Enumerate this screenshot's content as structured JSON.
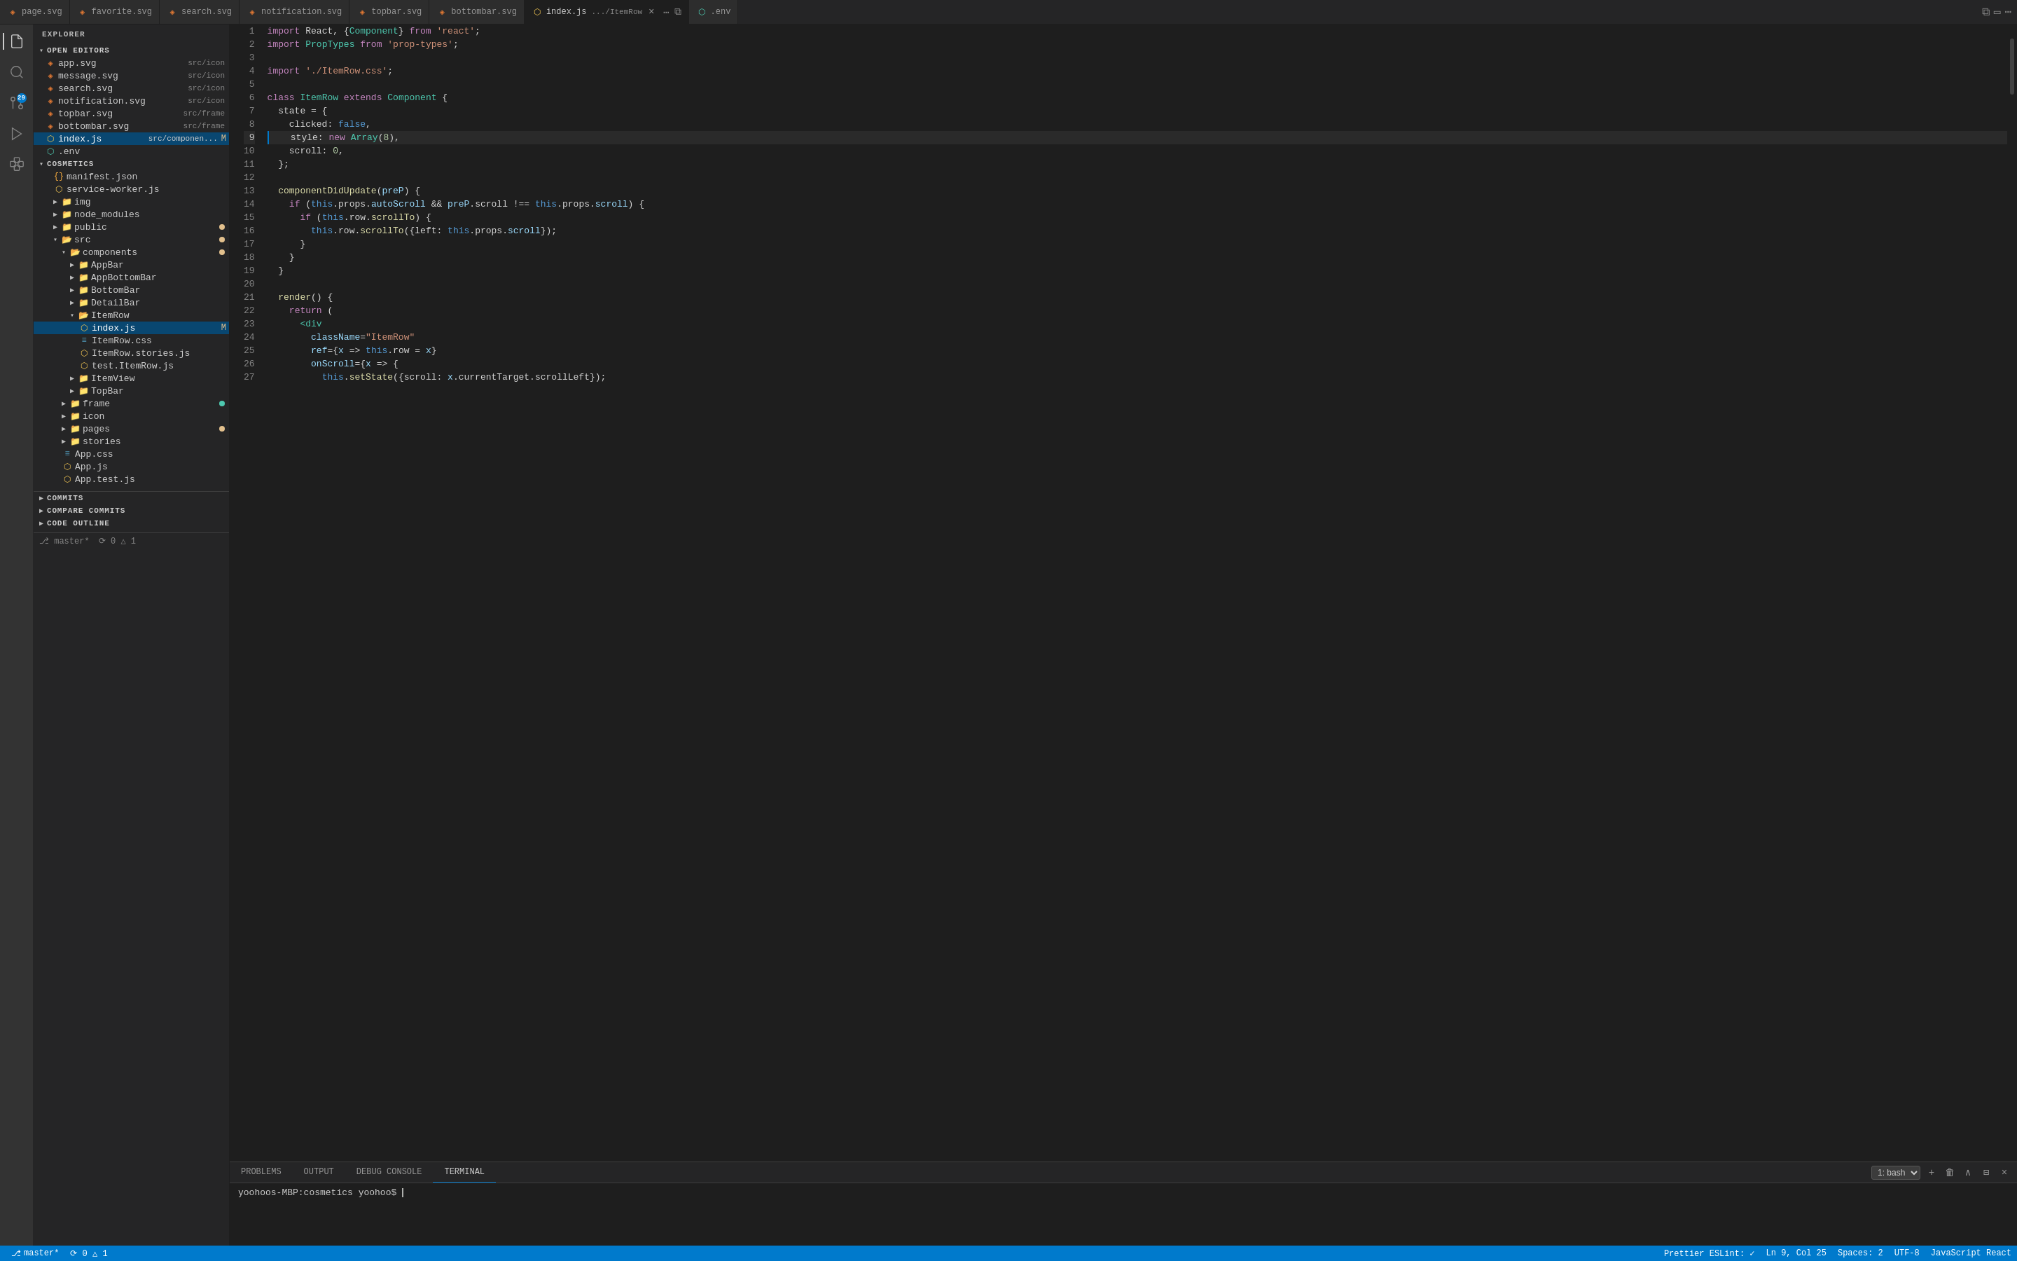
{
  "tabs": [
    {
      "label": "page.svg",
      "active": false,
      "modified": false,
      "color": "#e37933"
    },
    {
      "label": "favorite.svg",
      "active": false,
      "modified": false,
      "color": "#e37933"
    },
    {
      "label": "search.svg",
      "active": false,
      "modified": false,
      "color": "#e37933"
    },
    {
      "label": "notification.svg",
      "active": false,
      "modified": false,
      "color": "#e37933"
    },
    {
      "label": "topbar.svg",
      "active": false,
      "modified": false,
      "color": "#e37933"
    },
    {
      "label": "bottombar.svg",
      "active": false,
      "modified": false,
      "color": "#e37933"
    },
    {
      "label": "index.js",
      "active": true,
      "modified": true,
      "color": "#f1c553",
      "path": ".../ItemRow"
    },
    {
      "label": ".env",
      "active": false,
      "modified": false,
      "color": "#4ec9b0"
    }
  ],
  "sidebar": {
    "title": "EXPLORER",
    "sections": {
      "open_editors": "OPEN EDITORS",
      "cosmetics": "COSMETICS"
    }
  },
  "open_editors": [
    {
      "name": "app.svg",
      "path": "src/icon",
      "color": "#e37933"
    },
    {
      "name": "message.svg",
      "path": "src/icon",
      "color": "#e37933"
    },
    {
      "name": "search.svg",
      "path": "src/icon",
      "color": "#e37933"
    },
    {
      "name": "notification.svg",
      "path": "src/icon",
      "color": "#e37933"
    },
    {
      "name": "topbar.svg",
      "path": "src/frame",
      "color": "#e37933"
    },
    {
      "name": "bottombar.svg",
      "path": "src/frame",
      "color": "#e37933"
    },
    {
      "name": "index.js",
      "path": "src/componen...",
      "color": "#f1c553",
      "modified": true
    },
    {
      "name": ".env",
      "path": "",
      "color": "#4ec9b0"
    }
  ],
  "file_tree": [
    {
      "name": "manifest.json",
      "indent": 1,
      "color": "#f1a83e",
      "type": "json"
    },
    {
      "name": "service-worker.js",
      "indent": 1,
      "color": "#f1c553",
      "type": "js"
    },
    {
      "name": "img",
      "indent": 1,
      "color": "#dcb67a",
      "type": "folder"
    },
    {
      "name": "node_modules",
      "indent": 1,
      "color": "#dcb67a",
      "type": "folder"
    },
    {
      "name": "public",
      "indent": 1,
      "color": "#dcb67a",
      "type": "folder",
      "badge": "modified"
    },
    {
      "name": "src",
      "indent": 1,
      "color": "#dcb67a",
      "type": "folder",
      "badge": "modified",
      "expanded": true
    },
    {
      "name": "components",
      "indent": 2,
      "color": "#dcb67a",
      "type": "folder",
      "badge": "modified",
      "expanded": true
    },
    {
      "name": "AppBar",
      "indent": 3,
      "color": "#dcb67a",
      "type": "folder"
    },
    {
      "name": "AppBottomBar",
      "indent": 3,
      "color": "#dcb67a",
      "type": "folder"
    },
    {
      "name": "BottomBar",
      "indent": 3,
      "color": "#dcb67a",
      "type": "folder"
    },
    {
      "name": "DetailBar",
      "indent": 3,
      "color": "#dcb67a",
      "type": "folder"
    },
    {
      "name": "ItemRow",
      "indent": 3,
      "color": "#dcb67a",
      "type": "folder",
      "expanded": true
    },
    {
      "name": "index.js",
      "indent": 4,
      "color": "#f1c553",
      "type": "js",
      "modified": true,
      "active": true
    },
    {
      "name": "ItemRow.css",
      "indent": 4,
      "color": "#519aba",
      "type": "css"
    },
    {
      "name": "ItemRow.stories.js",
      "indent": 4,
      "color": "#f1c553",
      "type": "js"
    },
    {
      "name": "test.ItemRow.js",
      "indent": 4,
      "color": "#f1c553",
      "type": "js"
    },
    {
      "name": "ItemView",
      "indent": 3,
      "color": "#dcb67a",
      "type": "folder"
    },
    {
      "name": "TopBar",
      "indent": 3,
      "color": "#dcb67a",
      "type": "folder"
    },
    {
      "name": "frame",
      "indent": 2,
      "color": "#dcb67a",
      "type": "folder",
      "badge": "green",
      "expanded": false
    },
    {
      "name": "icon",
      "indent": 2,
      "color": "#dcb67a",
      "type": "folder"
    },
    {
      "name": "pages",
      "indent": 2,
      "color": "#dcb67a",
      "type": "folder",
      "badge": "modified"
    },
    {
      "name": "stories",
      "indent": 2,
      "color": "#dcb67a",
      "type": "folder"
    },
    {
      "name": "App.css",
      "indent": 2,
      "color": "#519aba",
      "type": "css"
    },
    {
      "name": "App.js",
      "indent": 2,
      "color": "#f1c553",
      "type": "js"
    },
    {
      "name": "App.test.js",
      "indent": 2,
      "color": "#f1c553",
      "type": "js"
    }
  ],
  "bottom_sections": [
    {
      "label": "COMMITS"
    },
    {
      "label": "COMPARE COMMITS"
    },
    {
      "label": "CODE OUTLINE"
    }
  ],
  "code_lines": [
    {
      "num": 1,
      "tokens": [
        {
          "t": "kw",
          "v": "import"
        },
        {
          "t": "punct",
          "v": " React, {"
        },
        {
          "t": "type",
          "v": "Component"
        },
        {
          "t": "punct",
          "v": "} "
        },
        {
          "t": "kw",
          "v": "from"
        },
        {
          "t": "str",
          "v": " 'react'"
        },
        {
          "t": "punct",
          "v": ";"
        }
      ]
    },
    {
      "num": 2,
      "tokens": [
        {
          "t": "kw",
          "v": "import"
        },
        {
          "t": "punct",
          "v": " "
        },
        {
          "t": "type",
          "v": "PropTypes"
        },
        {
          "t": "punct",
          "v": " "
        },
        {
          "t": "kw",
          "v": "from"
        },
        {
          "t": "str",
          "v": " 'prop-types'"
        },
        {
          "t": "punct",
          "v": ";"
        }
      ]
    },
    {
      "num": 3,
      "tokens": []
    },
    {
      "num": 4,
      "tokens": [
        {
          "t": "kw",
          "v": "import"
        },
        {
          "t": "str",
          "v": " './ItemRow.css'"
        },
        {
          "t": "punct",
          "v": ";"
        }
      ]
    },
    {
      "num": 5,
      "tokens": []
    },
    {
      "num": 6,
      "tokens": [
        {
          "t": "kw",
          "v": "class"
        },
        {
          "t": "punct",
          "v": " "
        },
        {
          "t": "type",
          "v": "ItemRow"
        },
        {
          "t": "punct",
          "v": " "
        },
        {
          "t": "kw",
          "v": "extends"
        },
        {
          "t": "punct",
          "v": " "
        },
        {
          "t": "type",
          "v": "Component"
        },
        {
          "t": "punct",
          "v": " {"
        }
      ]
    },
    {
      "num": 7,
      "tokens": [
        {
          "t": "plain",
          "v": "  state = {"
        }
      ]
    },
    {
      "num": 8,
      "tokens": [
        {
          "t": "plain",
          "v": "    clicked: "
        },
        {
          "t": "kw2",
          "v": "false"
        },
        {
          "t": "punct",
          "v": ","
        }
      ]
    },
    {
      "num": 9,
      "tokens": [
        {
          "t": "plain",
          "v": "    style: "
        },
        {
          "t": "kw",
          "v": "new"
        },
        {
          "t": "plain",
          "v": " "
        },
        {
          "t": "type",
          "v": "Array"
        },
        {
          "t": "punct",
          "v": "("
        },
        {
          "t": "num",
          "v": "8"
        },
        {
          "t": "punct",
          "v": "),"
        }
      ]
    },
    {
      "num": 10,
      "tokens": [
        {
          "t": "plain",
          "v": "    scroll: "
        },
        {
          "t": "num",
          "v": "0"
        },
        {
          "t": "punct",
          "v": ","
        }
      ]
    },
    {
      "num": 11,
      "tokens": [
        {
          "t": "plain",
          "v": "  };"
        }
      ]
    },
    {
      "num": 12,
      "tokens": []
    },
    {
      "num": 13,
      "tokens": [
        {
          "t": "plain",
          "v": "  "
        },
        {
          "t": "fn",
          "v": "componentDidUpdate"
        },
        {
          "t": "punct",
          "v": "("
        },
        {
          "t": "param",
          "v": "preP"
        },
        {
          "t": "punct",
          "v": ") {"
        }
      ]
    },
    {
      "num": 14,
      "tokens": [
        {
          "t": "plain",
          "v": "    "
        },
        {
          "t": "kw",
          "v": "if"
        },
        {
          "t": "punct",
          "v": " ("
        },
        {
          "t": "kw2",
          "v": "this"
        },
        {
          "t": "punct",
          "v": ".props."
        },
        {
          "t": "var",
          "v": "autoScroll"
        },
        {
          "t": "punct",
          "v": " && "
        },
        {
          "t": "param",
          "v": "preP"
        },
        {
          "t": "punct",
          "v": ".scroll "
        },
        {
          "t": "op",
          "v": "!=="
        },
        {
          "t": "punct",
          "v": " "
        },
        {
          "t": "kw2",
          "v": "this"
        },
        {
          "t": "punct",
          "v": ".props."
        },
        {
          "t": "var",
          "v": "scroll"
        },
        {
          "t": "punct",
          "v": ") {"
        }
      ]
    },
    {
      "num": 15,
      "tokens": [
        {
          "t": "plain",
          "v": "      "
        },
        {
          "t": "kw",
          "v": "if"
        },
        {
          "t": "punct",
          "v": " ("
        },
        {
          "t": "kw2",
          "v": "this"
        },
        {
          "t": "punct",
          "v": ".row."
        },
        {
          "t": "fn",
          "v": "scrollTo"
        },
        {
          "t": "punct",
          "v": ") {"
        }
      ]
    },
    {
      "num": 16,
      "tokens": [
        {
          "t": "plain",
          "v": "        "
        },
        {
          "t": "kw2",
          "v": "this"
        },
        {
          "t": "punct",
          "v": ".row."
        },
        {
          "t": "fn",
          "v": "scrollTo"
        },
        {
          "t": "punct",
          "v": "({left: "
        },
        {
          "t": "kw2",
          "v": "this"
        },
        {
          "t": "punct",
          "v": ".props."
        },
        {
          "t": "var",
          "v": "scroll"
        },
        {
          "t": "punct",
          "v": "});"
        }
      ]
    },
    {
      "num": 17,
      "tokens": [
        {
          "t": "plain",
          "v": "      }"
        }
      ]
    },
    {
      "num": 18,
      "tokens": [
        {
          "t": "plain",
          "v": "    }"
        }
      ]
    },
    {
      "num": 19,
      "tokens": [
        {
          "t": "plain",
          "v": "  }"
        }
      ]
    },
    {
      "num": 20,
      "tokens": []
    },
    {
      "num": 21,
      "tokens": [
        {
          "t": "plain",
          "v": "  "
        },
        {
          "t": "fn",
          "v": "render"
        },
        {
          "t": "punct",
          "v": "() {"
        }
      ]
    },
    {
      "num": 22,
      "tokens": [
        {
          "t": "plain",
          "v": "    "
        },
        {
          "t": "kw",
          "v": "return"
        },
        {
          "t": "punct",
          "v": " ("
        }
      ]
    },
    {
      "num": 23,
      "tokens": [
        {
          "t": "plain",
          "v": "      "
        },
        {
          "t": "jsx-tag",
          "v": "<div"
        }
      ]
    },
    {
      "num": 24,
      "tokens": [
        {
          "t": "plain",
          "v": "        "
        },
        {
          "t": "jsx-attr",
          "v": "className"
        },
        {
          "t": "punct",
          "v": "="
        },
        {
          "t": "jsx-str",
          "v": "\"ItemRow\""
        }
      ]
    },
    {
      "num": 25,
      "tokens": [
        {
          "t": "plain",
          "v": "        "
        },
        {
          "t": "jsx-attr",
          "v": "ref"
        },
        {
          "t": "punct",
          "v": "={"
        },
        {
          "t": "param",
          "v": "x"
        },
        {
          "t": "punct",
          "v": " => "
        },
        {
          "t": "kw2",
          "v": "this"
        },
        {
          "t": "punct",
          "v": ".row = "
        },
        {
          "t": "param",
          "v": "x"
        },
        {
          "t": "punct",
          "v": "}"
        }
      ]
    },
    {
      "num": 26,
      "tokens": [
        {
          "t": "plain",
          "v": "        "
        },
        {
          "t": "jsx-attr",
          "v": "onScroll"
        },
        {
          "t": "punct",
          "v": "={"
        },
        {
          "t": "param",
          "v": "x"
        },
        {
          "t": "punct",
          "v": " => {"
        }
      ]
    },
    {
      "num": 27,
      "tokens": [
        {
          "t": "plain",
          "v": "          "
        },
        {
          "t": "kw2",
          "v": "this"
        },
        {
          "t": "punct",
          "v": "."
        },
        {
          "t": "fn",
          "v": "setState"
        },
        {
          "t": "punct",
          "v": "({scroll: "
        },
        {
          "t": "param",
          "v": "x"
        },
        {
          "t": "punct",
          "v": ".currentTarget.scrollLeft});"
        }
      ]
    }
  ],
  "terminal": {
    "tabs": [
      "PROBLEMS",
      "OUTPUT",
      "DEBUG CONSOLE",
      "TERMINAL"
    ],
    "active_tab": "TERMINAL",
    "shell_label": "1: bash",
    "prompt": "yoohoos-MBP:cosmetics yoohoo$ "
  },
  "status_bar": {
    "branch": "master*",
    "sync": "⟳ 0 △ 1",
    "prettier": "Prettier ESLint: ✓",
    "position": "Ln 9, Col 25",
    "spaces": "Spaces: 2",
    "encoding": "UTF-8",
    "eol": "",
    "language": "JavaScript React"
  },
  "activity_bar": {
    "icons": [
      {
        "name": "files",
        "active": true
      },
      {
        "name": "search",
        "active": false
      },
      {
        "name": "source-control",
        "active": false,
        "badge": "29"
      },
      {
        "name": "run",
        "active": false
      },
      {
        "name": "extensions",
        "active": false
      }
    ]
  }
}
